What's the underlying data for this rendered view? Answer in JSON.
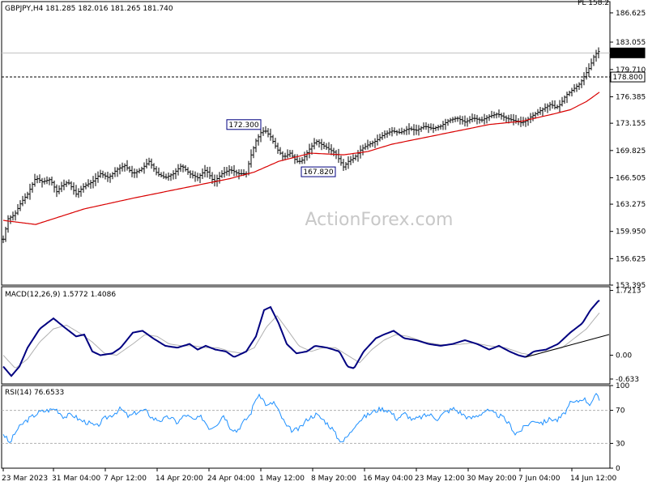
{
  "watermark": "ActionForex.com",
  "top_right_label": "PL 158.2",
  "chart_data": [
    {
      "type": "candlestick",
      "title": "GBPJPY,H4  181.285 182.016 181.265 181.740",
      "ylim": [
        153.395,
        188.0
      ],
      "y_ticks": [
        "186.625",
        "183.055",
        "179.710",
        "176.385",
        "173.155",
        "169.825",
        "166.505",
        "163.275",
        "159.950",
        "156.625",
        "153.395"
      ],
      "x_ticks": [
        "23 Mar 2023",
        "31 Mar 04:00",
        "7 Apr 12:00",
        "14 Apr 20:00",
        "24 Apr 04:00",
        "1 May 12:00",
        "8 May 20:00",
        "16 May 04:00",
        "23 May 12:00",
        "30 May 20:00",
        "7 Jun 04:00",
        "14 Jun 12:00"
      ],
      "price_key_points": [
        [
          0,
          159.0
        ],
        [
          6,
          161.5
        ],
        [
          14,
          162.0
        ],
        [
          22,
          163.5
        ],
        [
          30,
          164.5
        ],
        [
          40,
          166.5
        ],
        [
          48,
          166.0
        ],
        [
          58,
          166.3
        ],
        [
          66,
          164.8
        ],
        [
          72,
          165.5
        ],
        [
          80,
          166.0
        ],
        [
          90,
          164.5
        ],
        [
          100,
          165.5
        ],
        [
          110,
          166.0
        ],
        [
          120,
          167.0
        ],
        [
          130,
          166.5
        ],
        [
          140,
          167.5
        ],
        [
          150,
          168.0
        ],
        [
          160,
          167.0
        ],
        [
          170,
          167.5
        ],
        [
          180,
          168.5
        ],
        [
          190,
          167.0
        ],
        [
          200,
          166.5
        ],
        [
          210,
          167.0
        ],
        [
          220,
          168.0
        ],
        [
          230,
          167.0
        ],
        [
          240,
          166.5
        ],
        [
          250,
          167.5
        ],
        [
          260,
          166.0
        ],
        [
          270,
          167.0
        ],
        [
          280,
          167.5
        ],
        [
          290,
          167.0
        ],
        [
          300,
          167.0
        ],
        [
          305,
          169.0
        ],
        [
          312,
          171.0
        ],
        [
          318,
          172.0
        ],
        [
          323,
          172.3
        ],
        [
          330,
          171.5
        ],
        [
          338,
          170.0
        ],
        [
          346,
          169.0
        ],
        [
          354,
          169.5
        ],
        [
          362,
          168.5
        ],
        [
          368,
          168.5
        ],
        [
          378,
          170.0
        ],
        [
          386,
          171.0
        ],
        [
          394,
          170.5
        ],
        [
          402,
          170.0
        ],
        [
          410,
          169.5
        ],
        [
          416,
          168.5
        ],
        [
          420,
          167.82
        ],
        [
          426,
          168.5
        ],
        [
          434,
          169.0
        ],
        [
          442,
          170.0
        ],
        [
          450,
          170.5
        ],
        [
          460,
          171.0
        ],
        [
          470,
          171.8
        ],
        [
          480,
          172.2
        ],
        [
          490,
          172.0
        ],
        [
          500,
          172.5
        ],
        [
          510,
          172.3
        ],
        [
          520,
          172.8
        ],
        [
          530,
          172.5
        ],
        [
          540,
          172.8
        ],
        [
          550,
          173.5
        ],
        [
          560,
          173.8
        ],
        [
          570,
          173.3
        ],
        [
          580,
          173.8
        ],
        [
          590,
          173.5
        ],
        [
          600,
          174.0
        ],
        [
          610,
          174.3
        ],
        [
          620,
          173.8
        ],
        [
          630,
          173.5
        ],
        [
          640,
          173.2
        ],
        [
          646,
          173.5
        ],
        [
          652,
          174.0
        ],
        [
          660,
          174.5
        ],
        [
          668,
          175.0
        ],
        [
          676,
          175.5
        ],
        [
          682,
          175.0
        ],
        [
          688,
          175.5
        ],
        [
          694,
          176.5
        ],
        [
          700,
          177.0
        ],
        [
          706,
          177.5
        ],
        [
          712,
          178.0
        ],
        [
          718,
          179.0
        ],
        [
          724,
          180.0
        ],
        [
          730,
          181.5
        ],
        [
          736,
          182.0
        ],
        [
          741,
          181.74
        ]
      ],
      "ma_key_points": [
        [
          0,
          161.3
        ],
        [
          40,
          160.8
        ],
        [
          100,
          162.7
        ],
        [
          160,
          164.0
        ],
        [
          220,
          165.2
        ],
        [
          280,
          166.4
        ],
        [
          310,
          167.2
        ],
        [
          340,
          168.5
        ],
        [
          380,
          169.5
        ],
        [
          420,
          169.3
        ],
        [
          450,
          169.7
        ],
        [
          480,
          170.6
        ],
        [
          520,
          171.4
        ],
        [
          560,
          172.2
        ],
        [
          600,
          173.0
        ],
        [
          640,
          173.4
        ],
        [
          680,
          174.3
        ],
        [
          700,
          174.8
        ],
        [
          720,
          175.8
        ],
        [
          741,
          177.3
        ]
      ],
      "series": [
        {
          "name": "172.300",
          "kind": "price_label",
          "x": 318,
          "y": 172.3
        },
        {
          "name": "167.820",
          "kind": "price_label",
          "x": 420,
          "y": 167.82
        },
        {
          "name": "181.740",
          "kind": "current_price",
          "y": 181.74
        },
        {
          "name": "178.800",
          "kind": "level_line",
          "y": 178.8
        }
      ]
    },
    {
      "type": "line",
      "title": "MACD(12,26,9)  1.5772  1.4086",
      "ylim": [
        -0.763,
        1.82
      ],
      "y_ticks": [
        "1.7213",
        "0.00",
        "-0.633"
      ],
      "macd_key_points": [
        [
          0,
          -0.3
        ],
        [
          10,
          -0.55
        ],
        [
          20,
          -0.3
        ],
        [
          30,
          0.2
        ],
        [
          45,
          0.7
        ],
        [
          62,
          0.98
        ],
        [
          75,
          0.75
        ],
        [
          90,
          0.5
        ],
        [
          100,
          0.55
        ],
        [
          110,
          0.1
        ],
        [
          120,
          0.0
        ],
        [
          135,
          0.05
        ],
        [
          145,
          0.2
        ],
        [
          160,
          0.6
        ],
        [
          172,
          0.65
        ],
        [
          185,
          0.45
        ],
        [
          200,
          0.25
        ],
        [
          215,
          0.2
        ],
        [
          230,
          0.3
        ],
        [
          240,
          0.15
        ],
        [
          250,
          0.25
        ],
        [
          262,
          0.15
        ],
        [
          275,
          0.1
        ],
        [
          285,
          -0.05
        ],
        [
          300,
          0.1
        ],
        [
          312,
          0.5
        ],
        [
          322,
          1.2
        ],
        [
          330,
          1.28
        ],
        [
          340,
          0.85
        ],
        [
          350,
          0.3
        ],
        [
          362,
          0.05
        ],
        [
          375,
          0.1
        ],
        [
          385,
          0.25
        ],
        [
          400,
          0.2
        ],
        [
          415,
          0.1
        ],
        [
          425,
          -0.3
        ],
        [
          433,
          -0.35
        ],
        [
          445,
          0.1
        ],
        [
          460,
          0.45
        ],
        [
          470,
          0.55
        ],
        [
          482,
          0.65
        ],
        [
          495,
          0.45
        ],
        [
          510,
          0.4
        ],
        [
          525,
          0.3
        ],
        [
          540,
          0.25
        ],
        [
          555,
          0.3
        ],
        [
          570,
          0.4
        ],
        [
          585,
          0.3
        ],
        [
          600,
          0.15
        ],
        [
          612,
          0.25
        ],
        [
          625,
          0.1
        ],
        [
          636,
          0.0
        ],
        [
          645,
          -0.05
        ],
        [
          655,
          0.1
        ],
        [
          670,
          0.15
        ],
        [
          685,
          0.3
        ],
        [
          700,
          0.6
        ],
        [
          715,
          0.85
        ],
        [
          725,
          1.2
        ],
        [
          735,
          1.45
        ],
        [
          741,
          1.5
        ]
      ],
      "signal_key_points": [
        [
          0,
          0.0
        ],
        [
          15,
          -0.35
        ],
        [
          30,
          -0.1
        ],
        [
          45,
          0.35
        ],
        [
          62,
          0.7
        ],
        [
          78,
          0.8
        ],
        [
          95,
          0.58
        ],
        [
          110,
          0.35
        ],
        [
          125,
          0.05
        ],
        [
          140,
          0.0
        ],
        [
          160,
          0.3
        ],
        [
          175,
          0.55
        ],
        [
          190,
          0.5
        ],
        [
          205,
          0.3
        ],
        [
          220,
          0.25
        ],
        [
          235,
          0.25
        ],
        [
          250,
          0.2
        ],
        [
          265,
          0.2
        ],
        [
          280,
          0.1
        ],
        [
          295,
          0.05
        ],
        [
          310,
          0.2
        ],
        [
          325,
          0.75
        ],
        [
          338,
          1.05
        ],
        [
          350,
          0.7
        ],
        [
          365,
          0.25
        ],
        [
          380,
          0.1
        ],
        [
          395,
          0.2
        ],
        [
          410,
          0.2
        ],
        [
          425,
          0.0
        ],
        [
          440,
          -0.2
        ],
        [
          455,
          0.15
        ],
        [
          470,
          0.4
        ],
        [
          485,
          0.55
        ],
        [
          500,
          0.5
        ],
        [
          520,
          0.35
        ],
        [
          540,
          0.28
        ],
        [
          560,
          0.28
        ],
        [
          580,
          0.33
        ],
        [
          600,
          0.25
        ],
        [
          620,
          0.2
        ],
        [
          640,
          0.05
        ],
        [
          655,
          0.0
        ],
        [
          670,
          0.1
        ],
        [
          690,
          0.2
        ],
        [
          705,
          0.45
        ],
        [
          720,
          0.7
        ],
        [
          735,
          1.1
        ],
        [
          741,
          1.25
        ]
      ],
      "trendline": [
        [
          645,
          -0.05
        ],
        [
          752,
          0.55
        ]
      ]
    },
    {
      "type": "line",
      "title": "RSI(14)  76.6533",
      "ylim": [
        0,
        100
      ],
      "y_ticks": [
        "100",
        "70",
        "30",
        "0"
      ],
      "dashed_levels": [
        70,
        30
      ],
      "rsi_key_points": [
        [
          0,
          42
        ],
        [
          8,
          30
        ],
        [
          16,
          45
        ],
        [
          25,
          55
        ],
        [
          35,
          62
        ],
        [
          45,
          68
        ],
        [
          55,
          70
        ],
        [
          65,
          72
        ],
        [
          75,
          62
        ],
        [
          85,
          65
        ],
        [
          95,
          58
        ],
        [
          105,
          55
        ],
        [
          115,
          50
        ],
        [
          125,
          60
        ],
        [
          135,
          65
        ],
        [
          145,
          72
        ],
        [
          155,
          62
        ],
        [
          165,
          68
        ],
        [
          175,
          70
        ],
        [
          185,
          60
        ],
        [
          195,
          58
        ],
        [
          205,
          62
        ],
        [
          215,
          55
        ],
        [
          225,
          65
        ],
        [
          235,
          58
        ],
        [
          245,
          62
        ],
        [
          255,
          48
        ],
        [
          265,
          55
        ],
        [
          272,
          65
        ],
        [
          280,
          50
        ],
        [
          288,
          45
        ],
        [
          296,
          55
        ],
        [
          305,
          65
        ],
        [
          312,
          85
        ],
        [
          318,
          87
        ],
        [
          326,
          75
        ],
        [
          334,
          80
        ],
        [
          342,
          65
        ],
        [
          350,
          50
        ],
        [
          358,
          45
        ],
        [
          366,
          48
        ],
        [
          376,
          60
        ],
        [
          386,
          65
        ],
        [
          396,
          58
        ],
        [
          406,
          48
        ],
        [
          414,
          35
        ],
        [
          420,
          33
        ],
        [
          428,
          42
        ],
        [
          436,
          55
        ],
        [
          446,
          62
        ],
        [
          456,
          68
        ],
        [
          466,
          72
        ],
        [
          476,
          70
        ],
        [
          486,
          60
        ],
        [
          496,
          66
        ],
        [
          506,
          58
        ],
        [
          516,
          62
        ],
        [
          526,
          65
        ],
        [
          536,
          60
        ],
        [
          546,
          68
        ],
        [
          556,
          72
        ],
        [
          566,
          66
        ],
        [
          576,
          60
        ],
        [
          586,
          64
        ],
        [
          596,
          70
        ],
        [
          606,
          66
        ],
        [
          616,
          62
        ],
        [
          626,
          52
        ],
        [
          632,
          42
        ],
        [
          638,
          45
        ],
        [
          646,
          52
        ],
        [
          656,
          58
        ],
        [
          666,
          55
        ],
        [
          676,
          60
        ],
        [
          684,
          58
        ],
        [
          692,
          65
        ],
        [
          700,
          78
        ],
        [
          708,
          80
        ],
        [
          716,
          85
        ],
        [
          724,
          78
        ],
        [
          732,
          88
        ],
        [
          741,
          76
        ]
      ]
    }
  ]
}
